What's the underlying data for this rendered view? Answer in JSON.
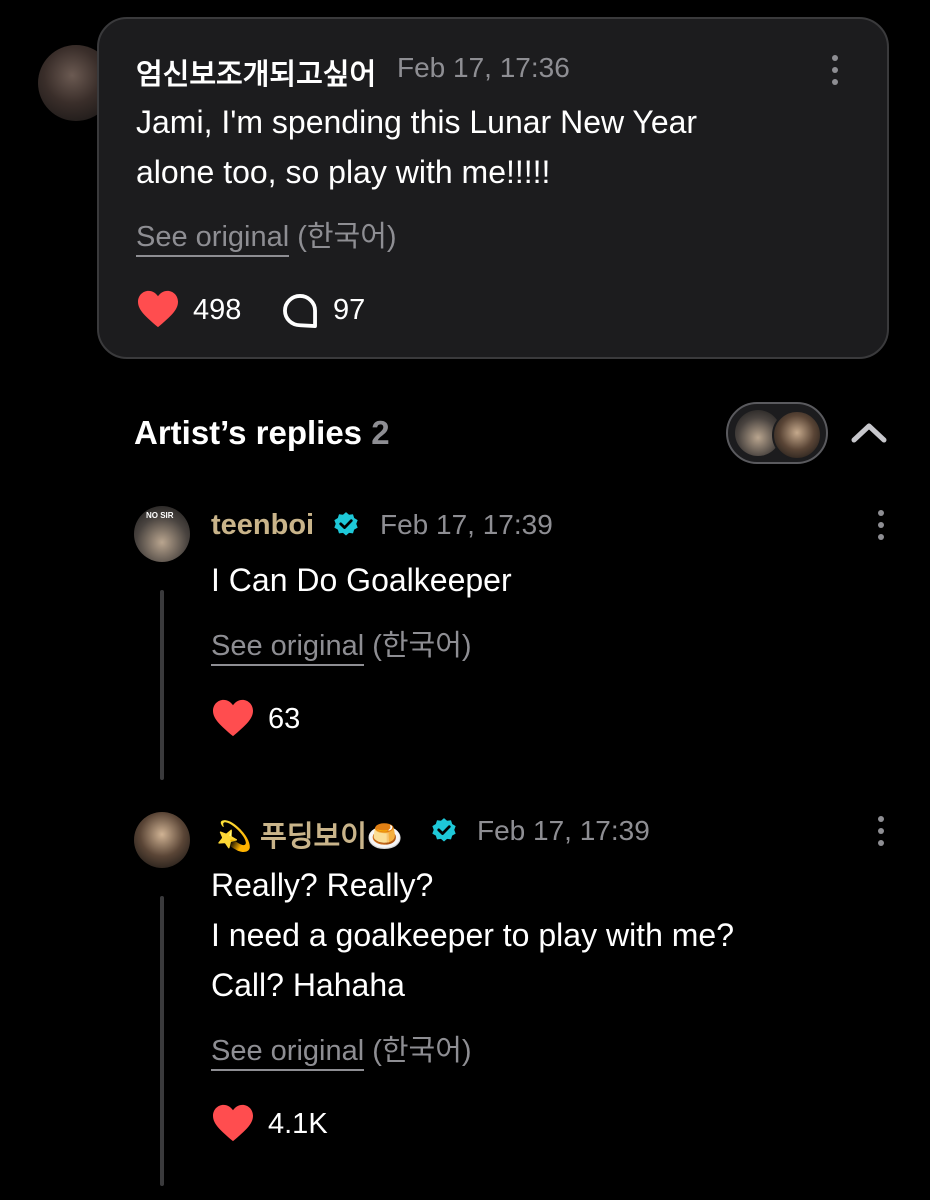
{
  "post": {
    "author": "엄신보조개되고싶어",
    "timestamp": "Feb 17, 17:36",
    "text": "Jami, I'm spending this Lunar New Year\nalone too, so play with me!!!!!",
    "see_original": "See original",
    "language": "(한국어)",
    "likes": "498",
    "comments": "97"
  },
  "replies_section": {
    "title": "Artist’s replies",
    "count": "2"
  },
  "replies": [
    {
      "author": "teenboi",
      "timestamp": "Feb 17, 17:39",
      "text": "I Can Do Goalkeeper",
      "see_original": "See original",
      "language": "(한국어)",
      "likes": "63",
      "hat_text": "NO SIR"
    },
    {
      "author_prefix_emoji": "💫",
      "author": "푸딩보이",
      "author_suffix_emoji": "🍮",
      "timestamp": "Feb 17, 17:39",
      "text": "Really? Really?\nI need a goalkeeper to play with me?\nCall? Hahaha",
      "see_original": "See original",
      "language": "(한국어)",
      "likes": "4.1K"
    }
  ],
  "colors": {
    "background": "#000000",
    "card": "#1c1c1e",
    "heart": "#ff4d4f",
    "verified": "#1ec8d8",
    "artist_name": "#c9b48a",
    "muted": "#8e8e93"
  }
}
